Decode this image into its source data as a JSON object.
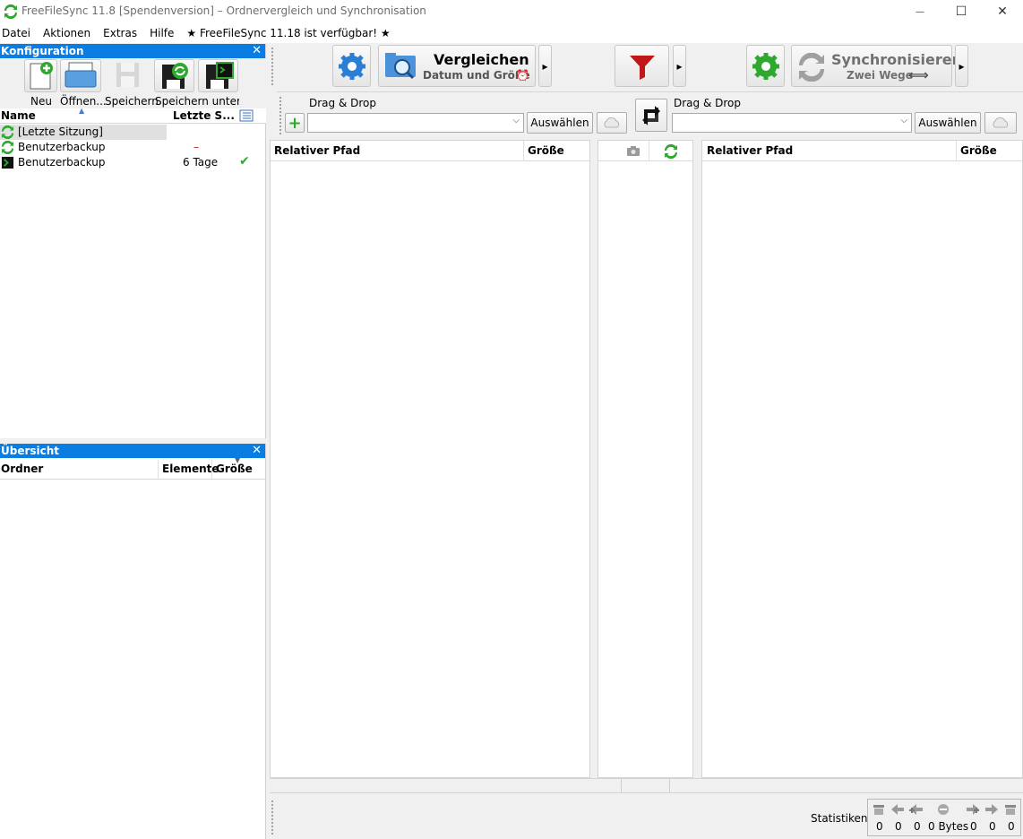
{
  "window": {
    "title": "FreeFileSync 11.8 [Spendenversion] – Ordnervergleich und Synchronisation",
    "minimize": "—",
    "maximize": "☐",
    "close": "✕"
  },
  "menu": [
    "Datei",
    "Aktionen",
    "Extras",
    "Hilfe",
    "★ FreeFileSync 11.18 ist verfügbar! ★"
  ],
  "config_panel": {
    "title": "Konfiguration",
    "close": "✕",
    "toolbar": [
      {
        "label": "Neu",
        "icon": "new-file-icon"
      },
      {
        "label": "Öffnen...",
        "icon": "open-folder-icon"
      },
      {
        "label": "Speichern",
        "icon": "save-disk-icon"
      },
      {
        "label": "Speichern unter...",
        "icon": "save-as-sync-icon"
      },
      {
        "label": "",
        "icon": "save-as-batch-icon"
      }
    ],
    "columns": {
      "name": "Name",
      "last": "Letzte S..."
    },
    "rows": [
      {
        "name": "[Letzte Sitzung]",
        "last": "",
        "status": "",
        "icon": "sync-icon"
      },
      {
        "name": "Benutzerbackup",
        "last": "–",
        "status": "",
        "icon": "sync-icon"
      },
      {
        "name": "Benutzerbackup",
        "last": "6 Tage",
        "status": "✔",
        "icon": "batch-icon"
      }
    ]
  },
  "overview_panel": {
    "title": "Übersicht",
    "close": "✕",
    "columns": {
      "folder": "Ordner",
      "items": "Elemente",
      "size": "Größe"
    }
  },
  "main_toolbar": {
    "compare_title": "Vergleichen",
    "compare_sub": "Datum und Größe",
    "sync_title": "Synchronisieren",
    "sync_sub": "Zwei Wege",
    "sync_arrow": "⟺",
    "dropdown": "▸"
  },
  "folders": {
    "left_label": "Drag & Drop",
    "right_label": "Drag & Drop",
    "left_value": "",
    "right_value": "",
    "select_label": "Auswählen",
    "add_label": "+"
  },
  "grid": {
    "left_path": "Relativer Pfad",
    "left_size": "Größe",
    "right_path": "Relativer Pfad",
    "right_size": "Größe"
  },
  "status": {
    "label": "Statistiken:",
    "counts": [
      "0",
      "0",
      "0",
      "0 Bytes",
      "0",
      "0",
      "0"
    ]
  },
  "colors": {
    "accent": "#0a7de3",
    "green": "#2fa82f",
    "red": "#c01818"
  }
}
